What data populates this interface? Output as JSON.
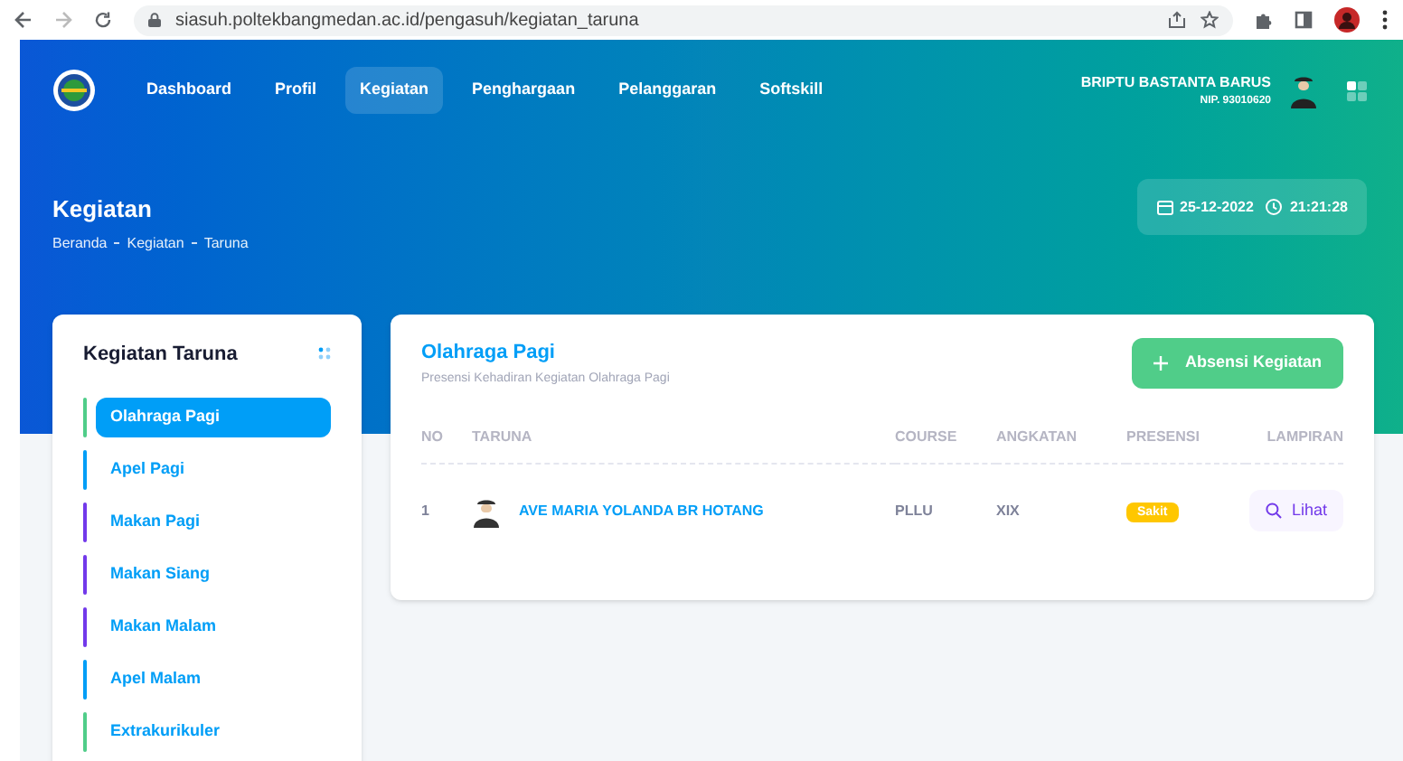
{
  "browser": {
    "url": "siasuh.poltekbangmedan.ac.id/pengasuh/kegiatan_taruna"
  },
  "nav": [
    {
      "label": "Dashboard",
      "selected": false
    },
    {
      "label": "Profil",
      "selected": false
    },
    {
      "label": "Kegiatan",
      "selected": true
    },
    {
      "label": "Penghargaan",
      "selected": false
    },
    {
      "label": "Pelanggaran",
      "selected": false
    },
    {
      "label": "Softskill",
      "selected": false
    }
  ],
  "user": {
    "name": "BRIPTU BASTANTA BARUS",
    "nip": "NIP. 93010620"
  },
  "page": {
    "title": "Kegiatan",
    "breadcrumb": [
      "Beranda",
      "Kegiatan",
      "Taruna"
    ],
    "date": "25-12-2022",
    "time": "21:21:28"
  },
  "sidebar": {
    "title": "Kegiatan Taruna",
    "items": [
      {
        "label": "Olahraga Pagi",
        "selected": true,
        "color": "#50cd89"
      },
      {
        "label": "Apel Pagi",
        "selected": false,
        "color": "#009ef7"
      },
      {
        "label": "Makan Pagi",
        "selected": false,
        "color": "#7239ea"
      },
      {
        "label": "Makan Siang",
        "selected": false,
        "color": "#7239ea"
      },
      {
        "label": "Makan Malam",
        "selected": false,
        "color": "#7239ea"
      },
      {
        "label": "Apel Malam",
        "selected": false,
        "color": "#009ef7"
      },
      {
        "label": "Extrakurikuler",
        "selected": false,
        "color": "#50cd89"
      }
    ]
  },
  "main": {
    "title": "Olahraga Pagi",
    "subtitle": "Presensi Kehadiran Kegiatan Olahraga Pagi",
    "button": "Absensi Kegiatan",
    "table": {
      "columns": [
        "NO",
        "TARUNA",
        "COURSE",
        "ANGKATAN",
        "PRESENSI",
        "LAMPIRAN"
      ],
      "rows": [
        {
          "no": "1",
          "taruna": "AVE MARIA YOLANDA BR HOTANG",
          "course": "PLLU",
          "angkatan": "XIX",
          "presensi": "Sakit",
          "lampiran": "Lihat"
        }
      ]
    }
  }
}
